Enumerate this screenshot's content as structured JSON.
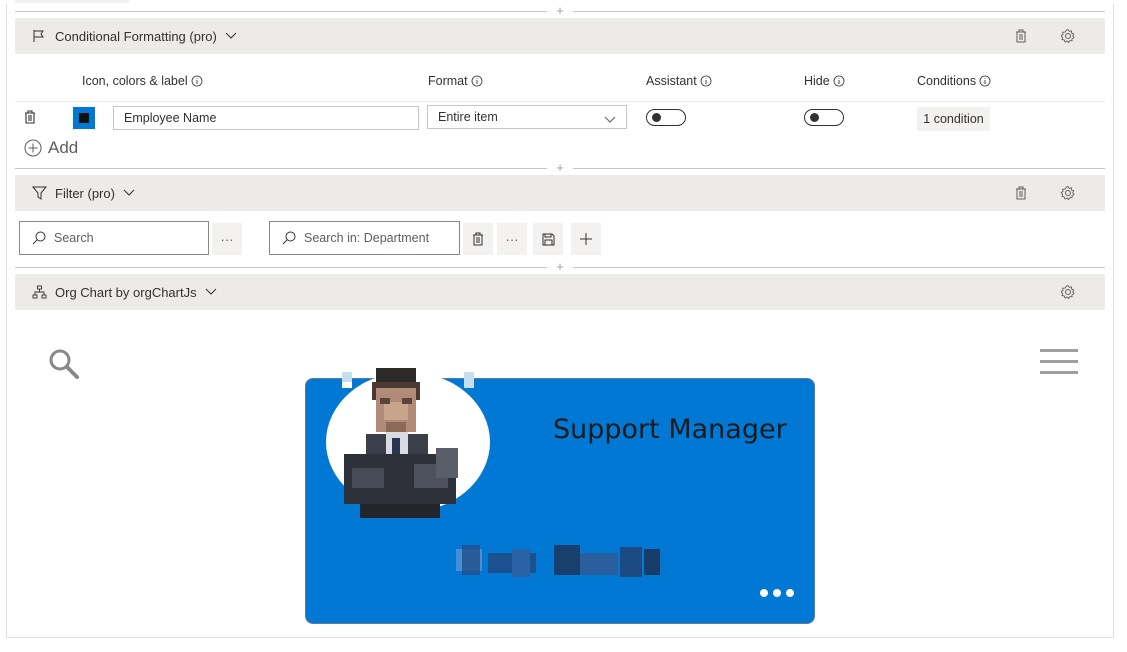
{
  "conditional_formatting": {
    "title": "Conditional Formatting (pro)",
    "columns": {
      "icon_colors_label": "Icon, colors & label",
      "format": "Format",
      "assistant": "Assistant",
      "hide": "Hide",
      "conditions": "Conditions"
    },
    "row": {
      "label_value": "Employee Name",
      "format_value": "Entire item",
      "assistant_on": false,
      "hide_on": false,
      "conditions_label": "1 condition"
    },
    "add_label": "Add",
    "swatch_color": "#0078d4"
  },
  "filter": {
    "title": "Filter (pro)",
    "search_placeholder": "Search",
    "search_in_placeholder": "Search in: Department",
    "more_label": "···"
  },
  "org_chart": {
    "title": "Org Chart by orgChartJs",
    "card": {
      "job_title": "Support Manager",
      "background": "#0078d4"
    }
  },
  "divider_plus": "+"
}
